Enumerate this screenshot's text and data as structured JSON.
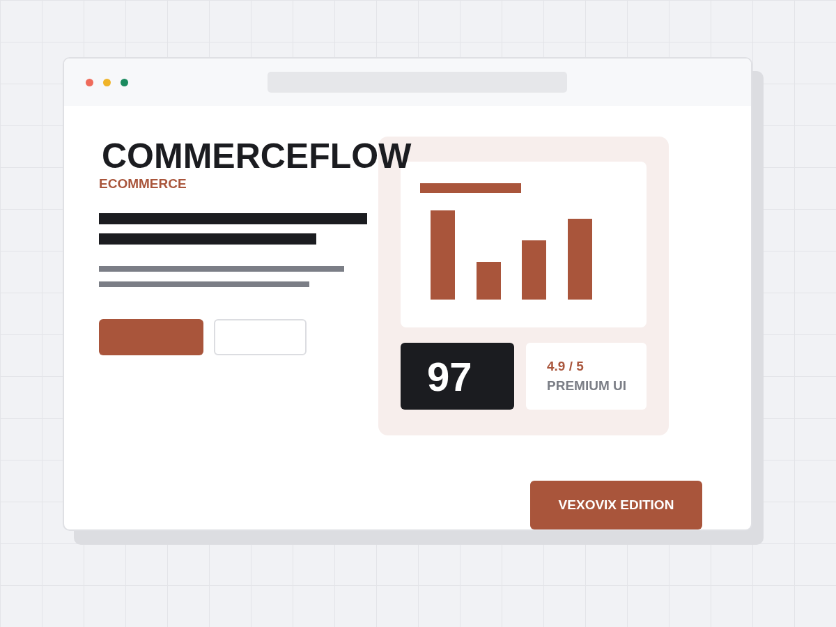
{
  "hero": {
    "title": "COMMERCEFLOW",
    "subtitle": "ECOMMERCE"
  },
  "stats": {
    "score": "97",
    "rating": "4.9 / 5",
    "tagline": "PREMIUM UI"
  },
  "edition_button": "VEXOVIX EDITION"
}
